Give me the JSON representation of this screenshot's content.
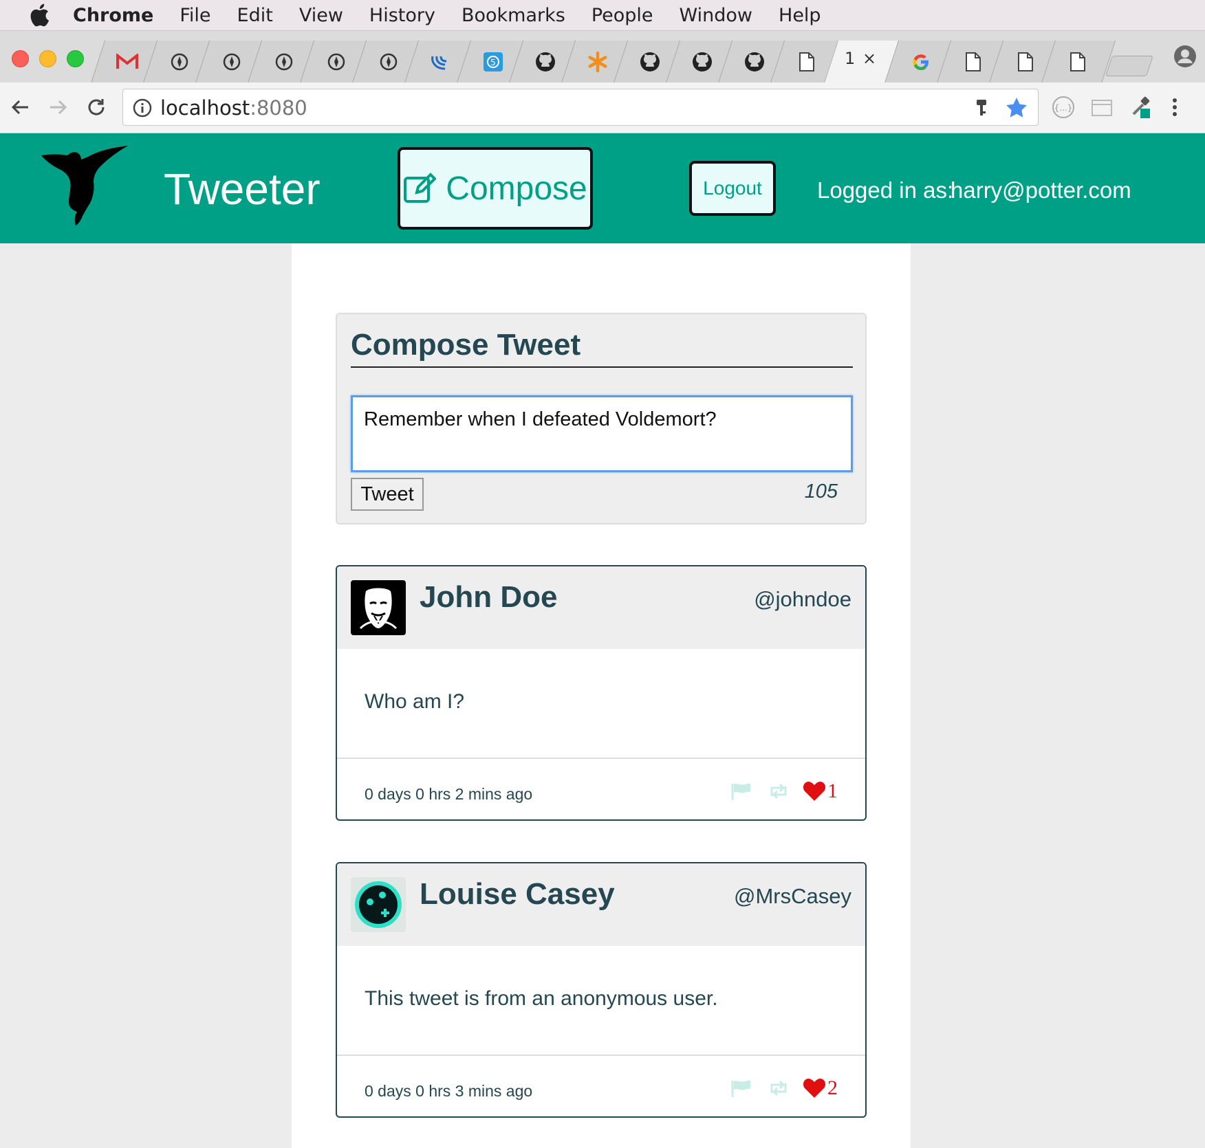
{
  "menubar": {
    "app": "Chrome",
    "items": [
      "File",
      "Edit",
      "View",
      "History",
      "Bookmarks",
      "People",
      "Window",
      "Help"
    ]
  },
  "tabs": {
    "favicons": [
      "gmail-icon",
      "chrome-app-icon",
      "chrome-app-icon",
      "chrome-app-icon",
      "chrome-app-icon",
      "chrome-app-icon",
      "jquery-icon",
      "html5-icon",
      "github-icon",
      "asterisk-icon",
      "github-icon",
      "github-icon",
      "github-icon",
      "document-icon",
      "active-tab",
      "google-icon",
      "document-icon",
      "document-icon",
      "document-icon"
    ],
    "active_title": "1",
    "active_close": "×"
  },
  "toolbar": {
    "url_host": "localhost",
    "url_port": ":8080"
  },
  "header": {
    "brand": "Tweeter",
    "compose_label": "Compose",
    "logout_label": "Logout",
    "logged_in_label": "Logged in as:",
    "logged_in_user": "harry@potter.com"
  },
  "compose": {
    "title": "Compose Tweet",
    "input_value": "Remember when I defeated Voldemort?",
    "button_label": "Tweet",
    "counter": "105"
  },
  "tweets": [
    {
      "name": "John Doe",
      "handle": "@johndoe",
      "text": "Who am I?",
      "time": "0 days 0 hrs 2 mins ago",
      "likes": "1",
      "avatar": "anonymous-mask-avatar"
    },
    {
      "name": "Louise Casey",
      "handle": "@MrsCasey",
      "text": "This tweet is from an anonymous user.",
      "time": "0 days 0 hrs 3 mins ago",
      "likes": "2",
      "avatar": "teal-circle-avatar"
    }
  ],
  "colors": {
    "brand_teal": "#00a087",
    "text_dark": "#244751",
    "like_red": "#e01010"
  }
}
